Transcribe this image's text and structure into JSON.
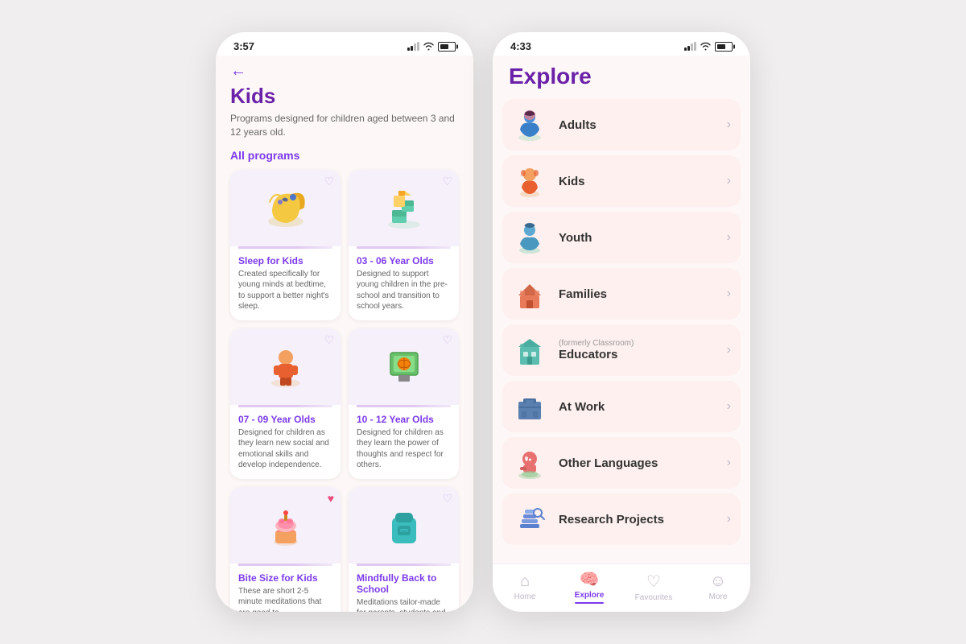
{
  "phone1": {
    "status_time": "3:57",
    "header": {
      "back_label": "←",
      "title": "Kids",
      "description": "Programs designed for children aged between 3 and 12 years old."
    },
    "section_label": "All programs",
    "programs": [
      {
        "name": "Sleep for Kids",
        "description": "Created specifically for young minds at bedtime, to support a better night's sleep.",
        "emoji": "🌙",
        "heart": "♡",
        "heart_active": false
      },
      {
        "name": "03 - 06 Year Olds",
        "description": "Designed to support young children in the pre-school and transition to school years.",
        "emoji": "🧩",
        "heart": "♡",
        "heart_active": false
      },
      {
        "name": "07 - 09 Year Olds",
        "description": "Designed for children as they learn new social and emotional skills and develop independence.",
        "emoji": "🧒",
        "heart": "♡",
        "heart_active": false
      },
      {
        "name": "10 - 12 Year Olds",
        "description": "Designed for children as they learn the power of thoughts and respect for others.",
        "emoji": "🏀",
        "heart": "♡",
        "heart_active": false
      },
      {
        "name": "Bite Size for Kids",
        "description": "These are short 2-5 minute meditations that are good to",
        "emoji": "🧁",
        "heart": "♥",
        "heart_active": true
      },
      {
        "name": "Mindfully Back to School",
        "description": "Meditations tailor-made for parents, students and",
        "emoji": "🎒",
        "heart": "♡",
        "heart_active": false
      }
    ]
  },
  "phone2": {
    "status_time": "4:33",
    "explore_title": "Explore",
    "categories": [
      {
        "name": "Adults",
        "subtitle": "",
        "icon_type": "adult"
      },
      {
        "name": "Kids",
        "subtitle": "",
        "icon_type": "kids"
      },
      {
        "name": "Youth",
        "subtitle": "",
        "icon_type": "youth"
      },
      {
        "name": "Families",
        "subtitle": "",
        "icon_type": "families"
      },
      {
        "name": "Educators",
        "subtitle": "(formerly Classroom)",
        "icon_type": "educators"
      },
      {
        "name": "At Work",
        "subtitle": "",
        "icon_type": "atwork"
      },
      {
        "name": "Other Languages",
        "subtitle": "",
        "icon_type": "languages"
      },
      {
        "name": "Research Projects",
        "subtitle": "",
        "icon_type": "research"
      }
    ],
    "nav": {
      "items": [
        {
          "label": "Home",
          "icon": "⌂",
          "active": false
        },
        {
          "label": "Explore",
          "icon": "🧠",
          "active": true
        },
        {
          "label": "Favourites",
          "icon": "♡",
          "active": false
        },
        {
          "label": "More",
          "icon": "☺",
          "active": false
        }
      ]
    }
  }
}
